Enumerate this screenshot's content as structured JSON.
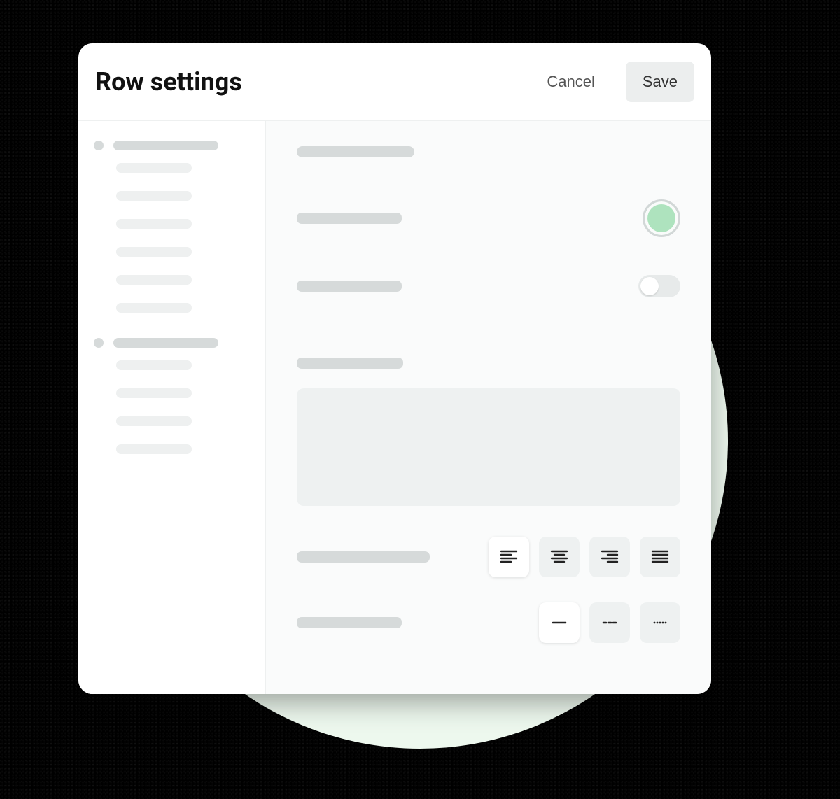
{
  "header": {
    "title": "Row settings",
    "cancel_label": "Cancel",
    "save_label": "Save"
  },
  "sidebar": {
    "sections": [
      {
        "items": 6
      },
      {
        "items": 4
      }
    ]
  },
  "main": {
    "color_swatch": "#aee3be",
    "toggle_on": false,
    "alignment_selected": 0,
    "border_selected": 0
  }
}
